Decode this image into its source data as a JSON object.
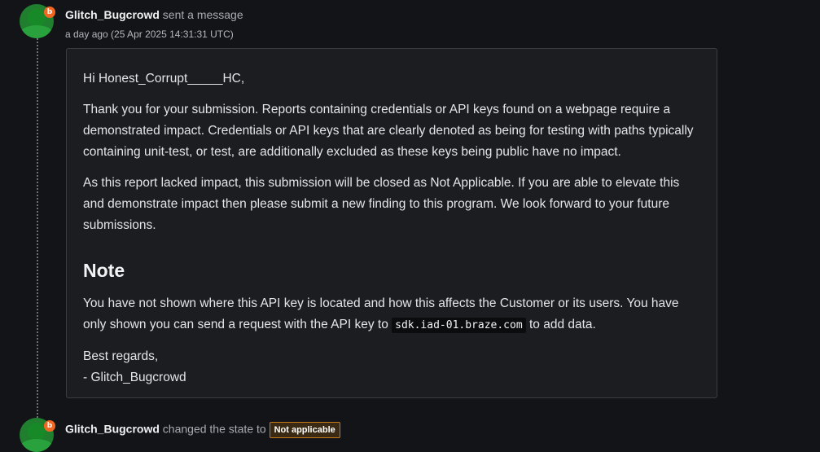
{
  "event1": {
    "author": "Glitch_Bugcrowd",
    "action": "sent a message",
    "timestamp": "a day ago (25 Apr 2025 14:31:31 UTC)",
    "avatar_badge": "b"
  },
  "message": {
    "greeting": "Hi Honest_Corrupt_____HC,",
    "paragraph1": "Thank you for your submission. Reports containing credentials or API keys found on a webpage require a demonstrated impact. Credentials or API keys that are clearly denoted as being for testing with paths typically containing unit-test, or test, are additionally excluded as these keys being public have no impact.",
    "paragraph2": "As this report lacked impact, this submission will be closed as Not Applicable. If you are able to elevate this and demonstrate impact then please submit a new finding to this program. We look forward to your future submissions.",
    "heading": "Note",
    "note_part1": "You have not shown where this API key is located and how this affects the Customer or its users. You have only shown you can send a request with the API key to ",
    "note_code": "sdk.iad-01.braze.com",
    "note_part2": " to add data.",
    "closing": "Best regards,",
    "signature": "- Glitch_Bugcrowd"
  },
  "event2": {
    "author": "Glitch_Bugcrowd",
    "action": "changed the state to",
    "state": "Not applicable",
    "avatar_badge": "b"
  },
  "colors": {
    "badge_orange": "#f26822",
    "avatar_green": "#1f7f2e",
    "state_border": "#c8791b"
  }
}
